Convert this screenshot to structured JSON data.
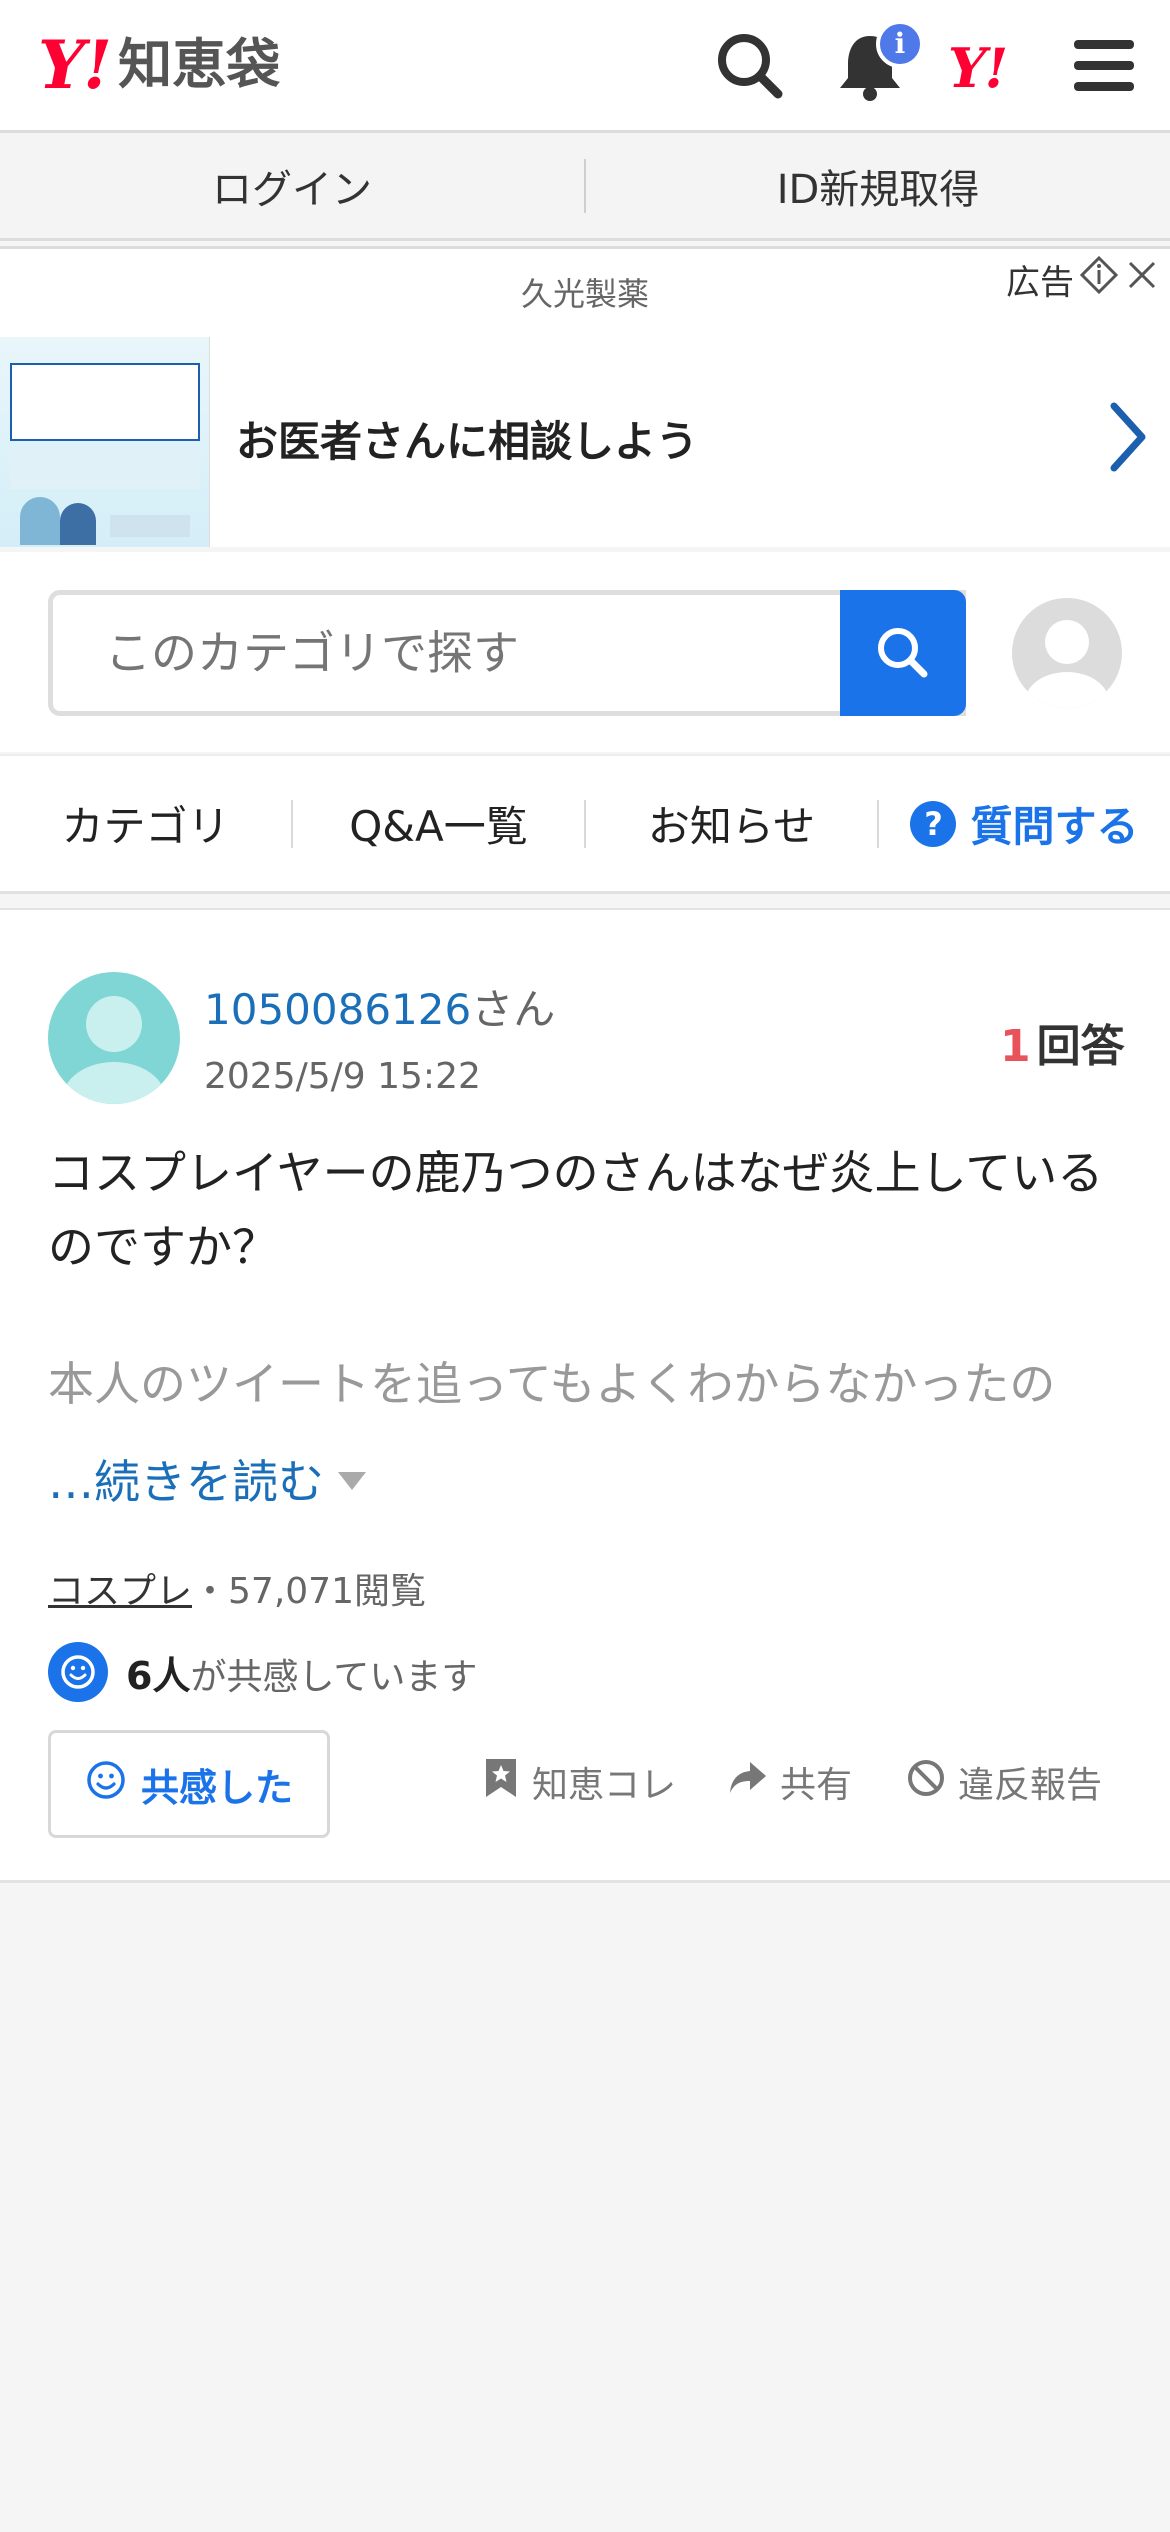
{
  "header": {
    "logo_y": "Y!",
    "logo_text": "知恵袋",
    "notification_count": "i",
    "yahoo_mark": "Y!"
  },
  "login_bar": {
    "login": "ログイン",
    "register": "ID新規取得"
  },
  "ad": {
    "sponsor": "久光製薬",
    "label": "広告",
    "title": "お医者さんに相談しよう"
  },
  "search": {
    "placeholder": "このカテゴリで探す"
  },
  "nav": {
    "category": "カテゴリ",
    "qa_list": "Q&A一覧",
    "notices": "お知らせ",
    "ask": "質問する",
    "ask_icon": "?"
  },
  "question": {
    "user_id": "1050086126",
    "user_suffix": "さん",
    "date": "2025/5/9 15:22",
    "answer_count": "1",
    "answer_label": "回答",
    "title": "コスプレイヤーの鹿乃つのさんはなぜ炎上しているのですか？",
    "body_preview": "本人のツイートを追ってもよくわからなかったの",
    "read_more": "…続きを読む",
    "category": "コスプレ",
    "view_count": "・57,071閲覧",
    "empathy_count": "6人",
    "empathy_text": "が共感しています",
    "empathy_button": "共感した",
    "save": "知恵コレ",
    "share": "共有",
    "report": "違反報告"
  },
  "colors": {
    "brand_red": "#ff0033",
    "accent_blue": "#1a73e8",
    "link_blue": "#1b6fb8",
    "answer_red": "#e8525a"
  }
}
